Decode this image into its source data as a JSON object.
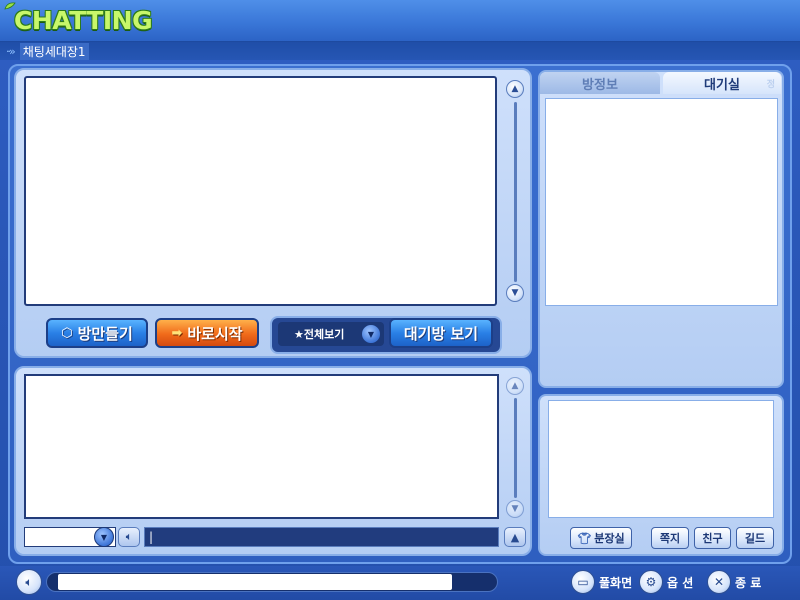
{
  "app": {
    "logo_text": "CHATTING",
    "breadcrumb_room": "채팅세대장1"
  },
  "room_buttons": {
    "make_room": "방만들기",
    "quick_start": "바로시작",
    "filter_selected": "★전체보기",
    "waiting_room_view": "대기방 보기"
  },
  "tabs": {
    "room_info": "방정보",
    "waiting_room": "대기실",
    "waiting_room_ghost": "정"
  },
  "user_buttons": {
    "dressing_room": "분장실",
    "message": "쪽지",
    "friend": "친구",
    "guild": "길드"
  },
  "bottom": {
    "fullscreen": "풀화면",
    "options": "옵 션",
    "exit": "종 료"
  },
  "chat_input": {
    "value": "|"
  },
  "icons": {
    "volume": "speaker-icon",
    "bell": "bell-icon",
    "fullscreen": "window-icon",
    "options": "gear-icon",
    "exit": "close-icon",
    "dressing_room": "shirt-icon",
    "scroll_up": "chevron-up-icon",
    "scroll_down": "chevron-down-icon"
  },
  "colors": {
    "background": "#2a57b8",
    "panel": "#cfe0fb",
    "accent_blue": "#2a80e6",
    "accent_orange": "#f06a1a",
    "logo_green": "#c8f76a"
  }
}
